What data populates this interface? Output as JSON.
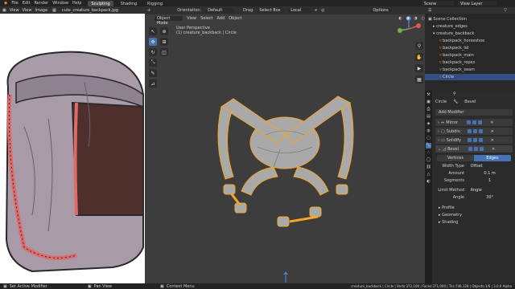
{
  "topbar": {
    "menus": [
      "File",
      "Edit",
      "Render",
      "Window",
      "Help"
    ],
    "tabs": [
      "Sculpting",
      "Shading",
      "Rigging"
    ],
    "active_tab": "Sculpting",
    "scene": "Scene",
    "view_layer": "View Layer"
  },
  "image_editor": {
    "menus": [
      "View",
      "View",
      "Image"
    ],
    "filename": "cute_creature_backpack.jpg"
  },
  "viewport": {
    "header": {
      "orientation_label": "Orientation:",
      "orientation_value": "Default",
      "drag_label": "Drag",
      "select_value": "Select Box",
      "transform_value": "Local",
      "options_label": "Options"
    },
    "mode": "Object Mode",
    "menus": [
      "View",
      "Select",
      "Add",
      "Object"
    ],
    "overlay_title": "User Perspective",
    "overlay_object": "(1) creature_backback | Circle"
  },
  "outliner": {
    "root": "Scene Collection",
    "items": [
      "creature_edges",
      "creature_backback",
      "backpack_horseshoe",
      "backpack_lid",
      "backpack_main",
      "backpack_ropes",
      "backpack_seam",
      "Circle"
    ],
    "selected": "Circle"
  },
  "properties": {
    "object_name": "Circle",
    "modifier_name": "Bevel",
    "add_modifier": "Add Modifier",
    "modifiers": [
      "Mirror",
      "Subdiv.",
      "Solidify",
      "Bevel"
    ],
    "bevel": {
      "mode_vertices": "Vertices",
      "mode_edges": "Edges",
      "width_type_label": "Width Type",
      "width_type_value": "Offset",
      "amount_label": "Amount",
      "amount_value": "0.1 m",
      "segments_label": "Segments",
      "segments_value": "1",
      "limit_method_label": "Limit Method",
      "limit_method_value": "Angle",
      "angle_label": "Angle",
      "angle_value": "30°",
      "sections": [
        "Profile",
        "Geometry",
        "Shading"
      ]
    }
  },
  "status": {
    "left": "Set Active Modifier",
    "middle1": "Pan View",
    "middle2": "Context Menu",
    "stats": "creature_backback | Circle | Verts:372,100 | Faces:371,000 | Tris:746,128 | Objects:1/6 | 3.0.0 Alpha"
  },
  "colors": {
    "accent": "#4772b3",
    "selection": "#f5a623",
    "viewport_bg": "#3d3d3d"
  }
}
